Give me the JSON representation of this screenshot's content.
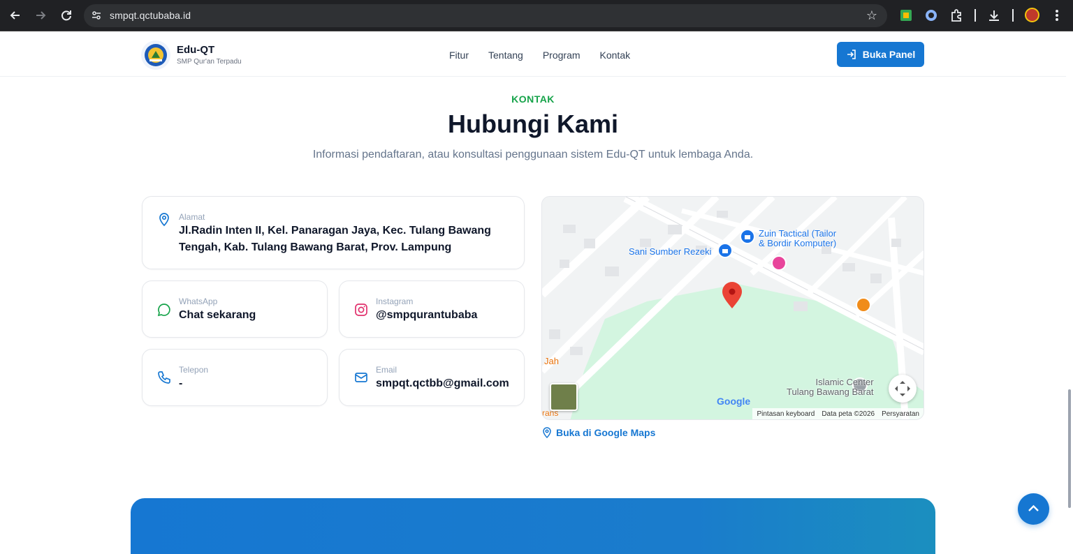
{
  "browser": {
    "url": "smpqt.qctubaba.id",
    "icons": {
      "back": "arrow-left-icon",
      "forward": "arrow-right-icon",
      "reload": "reload-icon",
      "site_info": "tune-icon",
      "bookmark": "star-icon",
      "download": "download-icon",
      "menu": "more-vert-icon"
    }
  },
  "header": {
    "brand_title": "Edu-QT",
    "brand_subtitle": "SMP Qur'an Terpadu",
    "nav": [
      "Fitur",
      "Tentang",
      "Program",
      "Kontak"
    ],
    "panel_button": "Buka Panel"
  },
  "section": {
    "eyebrow": "KONTAK",
    "title": "Hubungi Kami",
    "description": "Informasi pendaftaran, atau konsultasi penggunaan sistem Edu-QT untuk lembaga Anda."
  },
  "contact": {
    "address": {
      "label": "Alamat",
      "line1": "Jl.Radin Inten II, Kel. Panaragan Jaya, Kec. Tulang Bawang",
      "line2": "Tengah, Kab. Tulang Bawang Barat, Prov. Lampung",
      "icon": "map-pin-icon"
    },
    "whatsapp": {
      "label": "WhatsApp",
      "value": "Chat sekarang",
      "icon": "chat-icon"
    },
    "instagram": {
      "label": "Instagram",
      "value": "@smpqurantubaba",
      "icon": "instagram-icon"
    },
    "phone": {
      "label": "Telepon",
      "value": "-",
      "icon": "phone-icon"
    },
    "email": {
      "label": "Email",
      "value": "smpqt.qctbb@gmail.com",
      "icon": "mail-icon"
    }
  },
  "map": {
    "places": {
      "zuin_line1": "Zuin Tactical (Tailor",
      "zuin_line2": "& Bordir Komputer)",
      "sani": "Sani Sumber Rezeki",
      "islamic_line1": "Islamic Center",
      "islamic_line2": "Tulang Bawang Barat",
      "jah": "Jah",
      "rans": "rans"
    },
    "google_logo": "Google",
    "attribution": {
      "shortcuts": "Pintasan keyboard",
      "data": "Data peta ©2026",
      "terms": "Persyaratan"
    },
    "open_link": "Buka di Google Maps"
  },
  "colors": {
    "primary": "#1677d2",
    "accent_green": "#16a34a",
    "instagram": "#e1306c",
    "whatsapp": "#16a34a"
  }
}
